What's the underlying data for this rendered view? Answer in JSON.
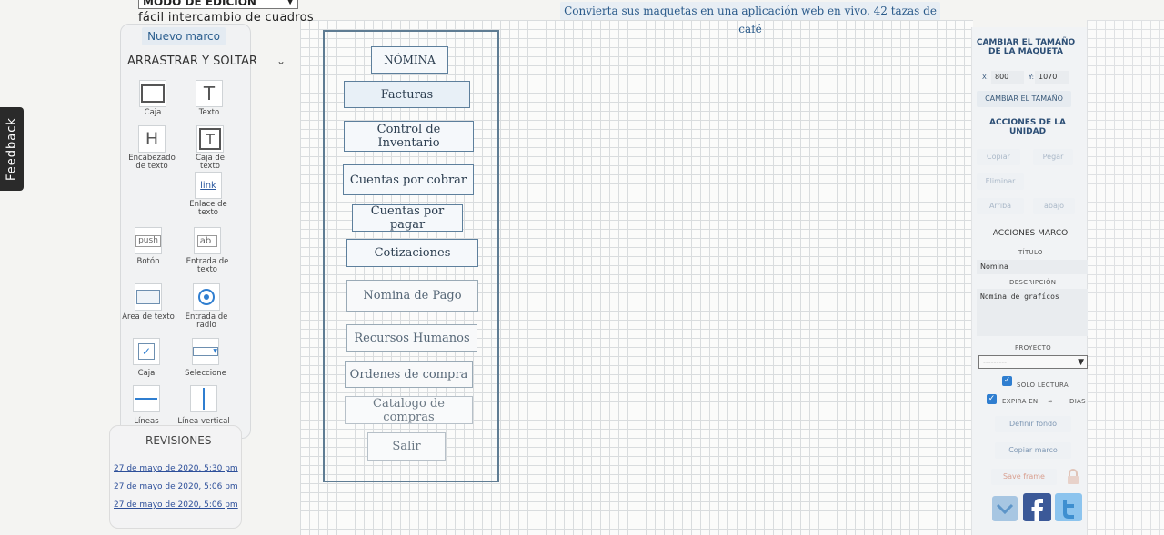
{
  "top": {
    "mode_select": "MODO DE EDICIÓN",
    "subtitle": "fácil intercambio de cuadros",
    "banner": "Convierta sus maquetas en una aplicación web en vivo. 42 tazas de café"
  },
  "feedback": {
    "label": "Feedback"
  },
  "left_panel": {
    "new_frame": "Nuevo marco",
    "drag_drop": "ARRASTRAR Y SOLTAR",
    "tools": {
      "box": "Caja",
      "text": "Texto",
      "heading": "Encabezado de texto",
      "textbox": "Caja de texto",
      "link": "Enlace de texto",
      "link_glyph": "link",
      "button": "Botón",
      "button_glyph": "push",
      "text_input": "Entrada de texto",
      "text_input_glyph": "ab",
      "textarea": "Área de texto",
      "radio": "Entrada de radio",
      "checkbox": "Caja",
      "select": "Seleccione",
      "lines": "Líneas",
      "vline": "Línea vertical"
    },
    "revisions": {
      "title": "REVISIONES",
      "items": [
        "27 de mayo de 2020, 5:30 pm",
        "27 de mayo de 2020, 5:06 pm",
        "27 de mayo de 2020, 5:06 pm"
      ]
    }
  },
  "frame": {
    "buttons": {
      "nomina": "NÓMINA",
      "facturas": "Facturas",
      "inventario": "Control de Inventario",
      "cobrar": "Cuentas por cobrar",
      "pagar": "Cuentas por pagar",
      "cotizaciones": "Cotizaciones",
      "nomina_pago": "Nomina de Pago",
      "rrhh": "Recursos Humanos",
      "ordenes": "Ordenes de compra",
      "catalogo": "Catalogo de compras",
      "salir": "Salir"
    }
  },
  "right_panel": {
    "resize_title": "CAMBIAR EL TAMAÑO DE LA MAQUETA",
    "x_label": "X:",
    "x_value": "800",
    "y_label": "Y:",
    "y_value": "1070",
    "resize_btn": "CAMBIAR EL TAMAÑO",
    "unit_actions": "ACCIONES DE LA UNIDAD",
    "copy": "Copiar",
    "paste": "Pegar",
    "delete": "Eliminar",
    "up": "Arriba",
    "down": "abajo",
    "frame_actions": "ACCIONES MARCO",
    "title_label": "TÍTULO",
    "title_value": "Nomina",
    "desc_label": "DESCRIPCIÓN",
    "desc_value": "Nomina de grafícos",
    "project_label": "PROYECTO",
    "project_value": "---------",
    "readonly": "SOLO LECTURA",
    "expires": "EXPIRA EN",
    "expires_value": "∞",
    "days": "DIAS",
    "set_bg": "Definir fondo",
    "copy_frame": "Copiar marco",
    "save_frame": "Save frame"
  },
  "colors": {
    "accent": "#2c5f8f",
    "frame_border": "#5f7c93",
    "facebook": "#3b5998",
    "twitter": "#55acee"
  }
}
